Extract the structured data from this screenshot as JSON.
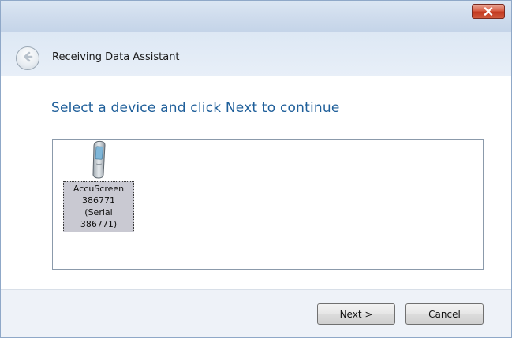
{
  "window": {
    "title_bar": {
      "close_icon": "close-icon"
    }
  },
  "header": {
    "back_icon": "back-arrow-icon",
    "title": "Receiving Data Assistant"
  },
  "main": {
    "instruction": "Select a device and click Next to continue",
    "devices": [
      {
        "icon": "handheld-device-icon",
        "label": "AccuScreen\n386771\n(Serial\n386771)",
        "selected": true
      }
    ]
  },
  "footer": {
    "next_label": "Next >",
    "cancel_label": "Cancel"
  },
  "colors": {
    "instruction_text": "#1f5f9a",
    "close_button": "#c3381f",
    "selection_bg": "#c9c9d2",
    "header_bg": "#dde8f4"
  }
}
